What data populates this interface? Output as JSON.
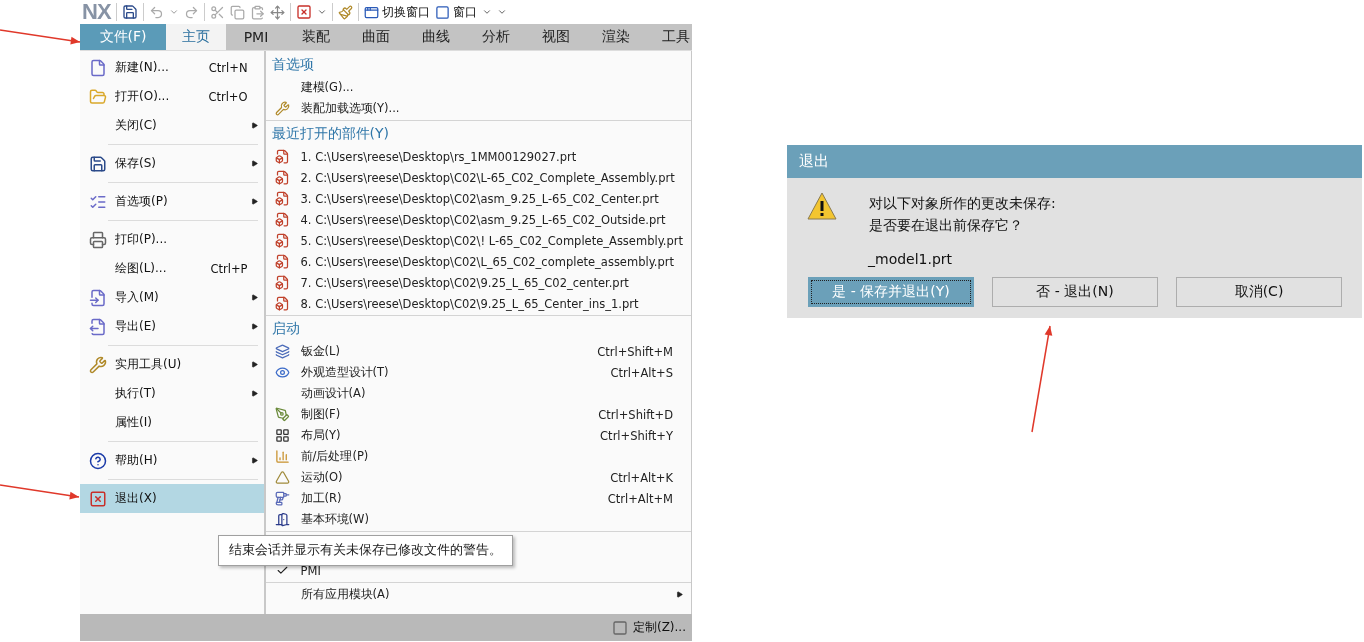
{
  "toolbar": {
    "logo": "NX",
    "window_buttons": [
      {
        "label": "切换窗口"
      },
      {
        "label": "窗口"
      }
    ]
  },
  "tabs": [
    {
      "label": "文件(F)",
      "kind": "file",
      "selected": false
    },
    {
      "label": "主页",
      "kind": "tab",
      "selected": true
    },
    {
      "label": "PMI",
      "kind": "tab",
      "selected": false
    },
    {
      "label": "装配",
      "kind": "tab",
      "selected": false
    },
    {
      "label": "曲面",
      "kind": "tab",
      "selected": false
    },
    {
      "label": "曲线",
      "kind": "tab",
      "selected": false
    },
    {
      "label": "分析",
      "kind": "tab",
      "selected": false
    },
    {
      "label": "视图",
      "kind": "tab",
      "selected": false
    },
    {
      "label": "渲染",
      "kind": "tab",
      "selected": false
    },
    {
      "label": "工具",
      "kind": "tab",
      "selected": false
    }
  ],
  "file_menu": {
    "groups": [
      [
        {
          "label": "新建(N)...",
          "shortcut": "Ctrl+N",
          "submenu": false,
          "highlighted": false
        },
        {
          "label": "打开(O)...",
          "shortcut": "Ctrl+O",
          "submenu": false,
          "highlighted": false
        },
        {
          "label": "关闭(C)",
          "submenu": true,
          "highlighted": false
        }
      ],
      [
        {
          "label": "保存(S)",
          "submenu": true,
          "highlighted": false
        }
      ],
      [
        {
          "label": "首选项(P)",
          "submenu": true,
          "highlighted": false
        }
      ],
      [
        {
          "label": "打印(P)...",
          "submenu": false,
          "highlighted": false
        },
        {
          "label": "绘图(L)...",
          "shortcut": "Ctrl+P",
          "submenu": false,
          "highlighted": false
        },
        {
          "label": "导入(M)",
          "submenu": true,
          "highlighted": false
        },
        {
          "label": "导出(E)",
          "submenu": true,
          "highlighted": false
        }
      ],
      [
        {
          "label": "实用工具(U)",
          "submenu": true,
          "highlighted": false
        },
        {
          "label": "执行(T)",
          "submenu": true,
          "highlighted": false
        },
        {
          "label": "属性(I)",
          "submenu": false,
          "highlighted": false
        }
      ],
      [
        {
          "label": "帮助(H)",
          "submenu": true,
          "highlighted": false
        }
      ],
      [
        {
          "label": "退出(X)",
          "submenu": false,
          "highlighted": true
        }
      ]
    ],
    "sections": [
      {
        "title": "首选项",
        "items": [
          {
            "label": "建模(G)..."
          },
          {
            "label": "装配加载选项(Y)..."
          }
        ]
      },
      {
        "title": "最近打开的部件(Y)",
        "items": [
          {
            "label": "1. C:\\Users\\reese\\Desktop\\rs_1MM00129027.prt"
          },
          {
            "label": "2. C:\\Users\\reese\\Desktop\\C02\\L-65_C02_Complete_Assembly.prt"
          },
          {
            "label": "3. C:\\Users\\reese\\Desktop\\C02\\asm_9.25_L-65_C02_Center.prt"
          },
          {
            "label": "4. C:\\Users\\reese\\Desktop\\C02\\asm_9.25_L-65_C02_Outside.prt"
          },
          {
            "label": "5. C:\\Users\\reese\\Desktop\\C02\\! L-65_C02_Complete_Assembly.prt"
          },
          {
            "label": "6. C:\\Users\\reese\\Desktop\\C02\\L_65_C02_complete_assembly.prt"
          },
          {
            "label": "7. C:\\Users\\reese\\Desktop\\C02\\9.25_L_65_C02_center.prt"
          },
          {
            "label": "8. C:\\Users\\reese\\Desktop\\C02\\9.25_L_65_Center_ins_1.prt"
          }
        ]
      },
      {
        "title": "启动",
        "items": [
          {
            "label": "钣金(L)",
            "shortcut": "Ctrl+Shift+M"
          },
          {
            "label": "外观造型设计(T)",
            "shortcut": "Ctrl+Alt+S"
          },
          {
            "label": "动画设计(A)"
          },
          {
            "label": "制图(F)",
            "shortcut": "Ctrl+Shift+D"
          },
          {
            "label": "布局(Y)",
            "shortcut": "Ctrl+Shift+Y"
          },
          {
            "label": "前/后处理(P)"
          },
          {
            "label": "运动(O)",
            "shortcut": "Ctrl+Alt+K"
          },
          {
            "label": "加工(R)",
            "shortcut": "Ctrl+Alt+M"
          },
          {
            "label": "基本环境(W)"
          }
        ]
      },
      {
        "items": [
          {
            "label": "PMI",
            "checked": true
          }
        ]
      },
      {
        "items": [
          {
            "label": "所有应用模块(A)",
            "submenu": true
          }
        ]
      }
    ]
  },
  "tooltip": "结束会话并显示有关未保存已修改文件的警告。",
  "status_bar": {
    "button": "定制(Z)..."
  },
  "dialog": {
    "title": "退出",
    "message": [
      "对以下对象所作的更改未保存:",
      "是否要在退出前保存它？"
    ],
    "file": "_model1.prt",
    "buttons": [
      {
        "label": "是 - 保存并退出(Y)",
        "focused": true
      },
      {
        "label": "否 - 退出(N)",
        "focused": false
      },
      {
        "label": "取消(C)",
        "focused": false
      }
    ]
  }
}
